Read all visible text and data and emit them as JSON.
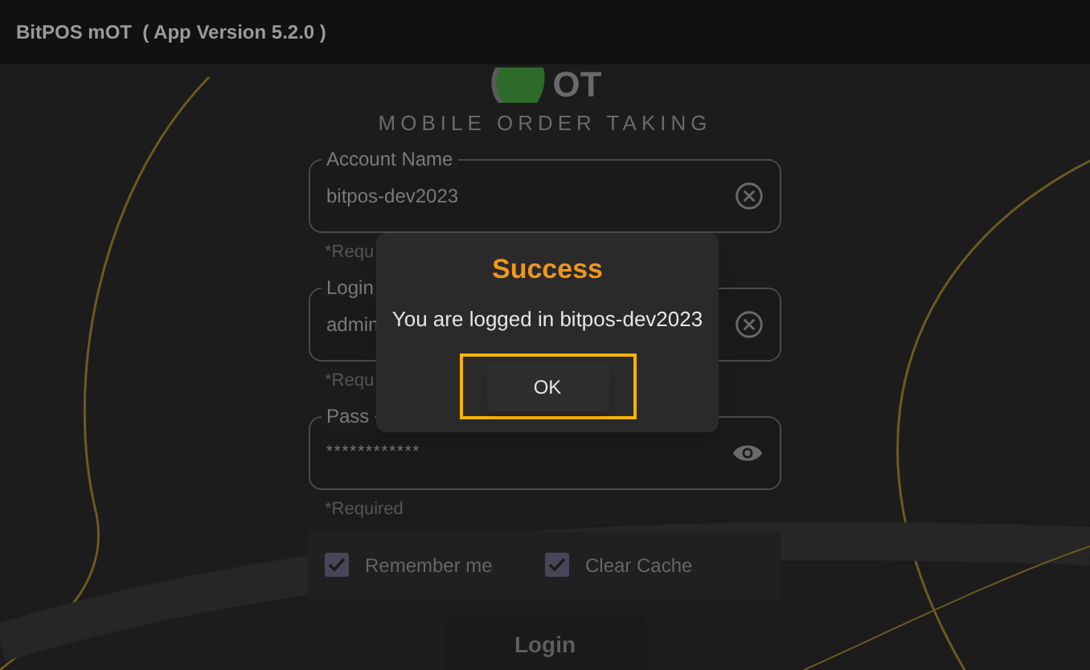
{
  "title_bar": {
    "title": "BitPOS mOT  ( App Version 5.2.0 )"
  },
  "logo": {
    "text": "OT",
    "subtitle": "MOBILE ORDER TAKING"
  },
  "fields": [
    {
      "label": "Account Name",
      "value": "bitpos-dev2023",
      "kind": "text",
      "hint": "*Requ"
    },
    {
      "label": "Login",
      "value": "admin",
      "kind": "text",
      "hint": "*Requ"
    },
    {
      "label": "Pass",
      "value": "************",
      "kind": "password",
      "hint": "*Required"
    }
  ],
  "options": [
    {
      "label": "Remember me",
      "checked": true
    },
    {
      "label": "Clear Cache",
      "checked": true
    }
  ],
  "login_button": "Login",
  "dialog": {
    "title": "Success",
    "message": "You are logged in bitpos-dev2023",
    "button": "OK",
    "highlighted": true
  }
}
